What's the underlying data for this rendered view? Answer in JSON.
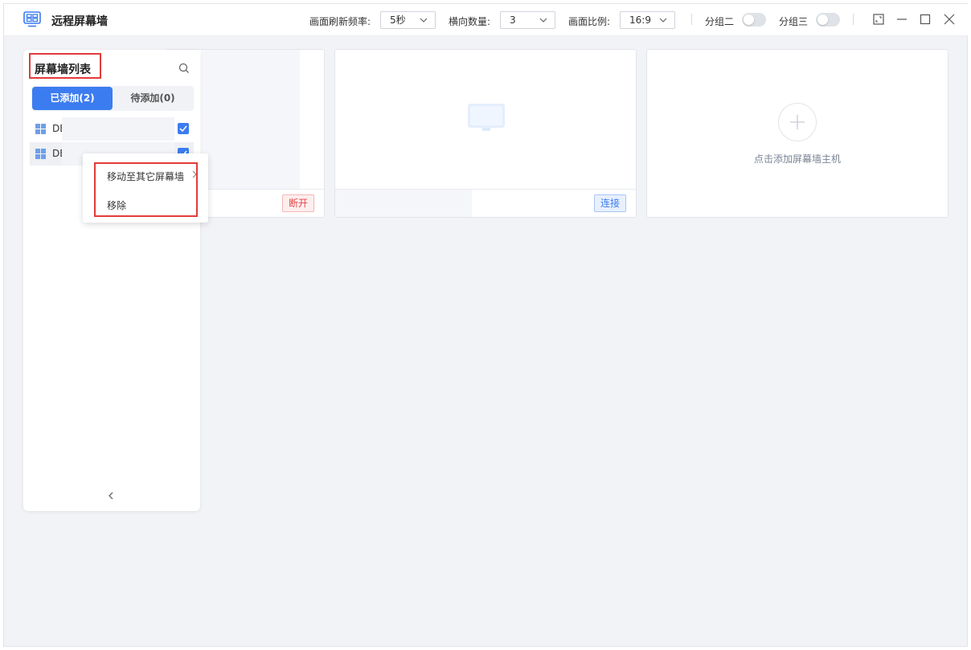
{
  "app": {
    "title": "远程屏幕墙"
  },
  "toolbar": {
    "refresh_label": "画面刷新频率:",
    "refresh_value": "5秒",
    "columns_label": "横向数量:",
    "columns_value": "3",
    "ratio_label": "画面比例:",
    "ratio_value": "16:9",
    "group2_label": "分组二",
    "group3_label": "分组三"
  },
  "sidebar": {
    "title": "屏幕墙列表",
    "tabs": [
      {
        "label": "已添加(2)",
        "active": true
      },
      {
        "label": "待添加(0)",
        "active": false
      }
    ],
    "items": [
      {
        "name": "DE",
        "checked": true
      },
      {
        "name": "DE",
        "checked": true
      }
    ]
  },
  "context_menu": {
    "items": [
      {
        "label": "移动至其它屏幕墙"
      },
      {
        "label": "移除"
      }
    ]
  },
  "cards": [
    {
      "button": "断开",
      "status": "disconnect"
    },
    {
      "button": "连接",
      "status": "connect"
    },
    {
      "add_label": "点击添加屏幕墙主机"
    }
  ],
  "colors": {
    "accent": "#3b7cf0",
    "danger": "#e24848",
    "highlight_box": "#e23b3b"
  }
}
